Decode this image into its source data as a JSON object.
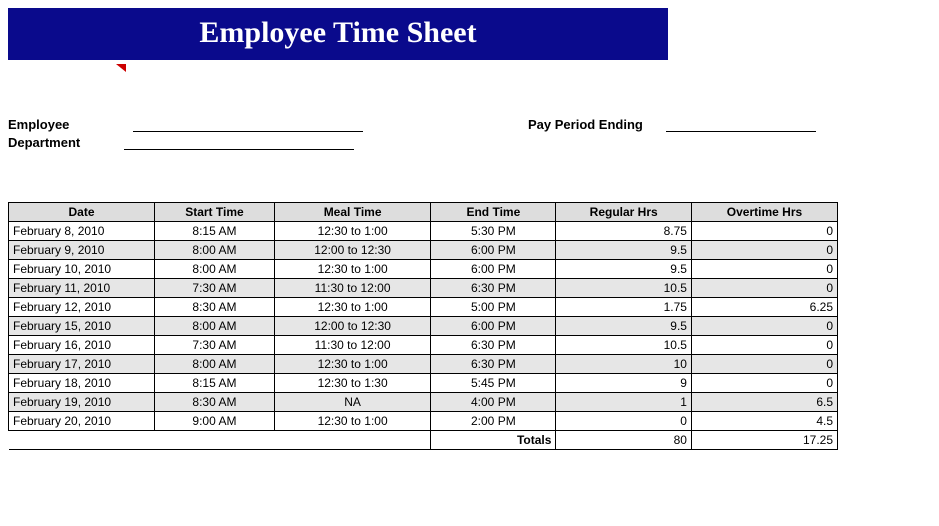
{
  "title": "Employee Time Sheet",
  "labels": {
    "employee": "Employee",
    "department": "Department",
    "pay_period_ending": "Pay Period Ending"
  },
  "columns": {
    "date": "Date",
    "start": "Start Time",
    "meal": "Meal Time",
    "end": "End Time",
    "regular": "Regular Hrs",
    "overtime": "Overtime Hrs"
  },
  "rows": [
    {
      "date": "February 8, 2010",
      "start": "8:15 AM",
      "meal": "12:30 to 1:00",
      "end": "5:30 PM",
      "regular": "8.75",
      "overtime": "0"
    },
    {
      "date": "February 9, 2010",
      "start": "8:00 AM",
      "meal": "12:00 to 12:30",
      "end": "6:00 PM",
      "regular": "9.5",
      "overtime": "0"
    },
    {
      "date": "February 10, 2010",
      "start": "8:00 AM",
      "meal": "12:30 to 1:00",
      "end": "6:00 PM",
      "regular": "9.5",
      "overtime": "0"
    },
    {
      "date": "February 11, 2010",
      "start": "7:30 AM",
      "meal": "11:30 to 12:00",
      "end": "6:30 PM",
      "regular": "10.5",
      "overtime": "0"
    },
    {
      "date": "February 12, 2010",
      "start": "8:30 AM",
      "meal": "12:30 to 1:00",
      "end": "5:00 PM",
      "regular": "1.75",
      "overtime": "6.25"
    },
    {
      "date": "February 15, 2010",
      "start": "8:00 AM",
      "meal": "12:00 to 12:30",
      "end": "6:00 PM",
      "regular": "9.5",
      "overtime": "0"
    },
    {
      "date": "February 16, 2010",
      "start": "7:30 AM",
      "meal": "11:30 to 12:00",
      "end": "6:30 PM",
      "regular": "10.5",
      "overtime": "0"
    },
    {
      "date": "February 17, 2010",
      "start": "8:00 AM",
      "meal": "12:30 to 1:00",
      "end": "6:30 PM",
      "regular": "10",
      "overtime": "0"
    },
    {
      "date": "February 18, 2010",
      "start": "8:15 AM",
      "meal": "12:30 to 1:30",
      "end": "5:45 PM",
      "regular": "9",
      "overtime": "0"
    },
    {
      "date": "February 19, 2010",
      "start": "8:30 AM",
      "meal": "NA",
      "end": "4:00 PM",
      "regular": "1",
      "overtime": "6.5"
    },
    {
      "date": "February 20, 2010",
      "start": "9:00 AM",
      "meal": "12:30 to 1:00",
      "end": "2:00 PM",
      "regular": "0",
      "overtime": "4.5"
    }
  ],
  "totals": {
    "label": "Totals",
    "regular": "80",
    "overtime": "17.25"
  },
  "chart_data": {
    "type": "table",
    "title": "Employee Time Sheet",
    "columns": [
      "Date",
      "Start Time",
      "Meal Time",
      "End Time",
      "Regular Hrs",
      "Overtime Hrs"
    ],
    "rows": [
      [
        "February 8, 2010",
        "8:15 AM",
        "12:30 to 1:00",
        "5:30 PM",
        8.75,
        0
      ],
      [
        "February 9, 2010",
        "8:00 AM",
        "12:00 to 12:30",
        "6:00 PM",
        9.5,
        0
      ],
      [
        "February 10, 2010",
        "8:00 AM",
        "12:30 to 1:00",
        "6:00 PM",
        9.5,
        0
      ],
      [
        "February 11, 2010",
        "7:30 AM",
        "11:30 to 12:00",
        "6:30 PM",
        10.5,
        0
      ],
      [
        "February 12, 2010",
        "8:30 AM",
        "12:30 to 1:00",
        "5:00 PM",
        1.75,
        6.25
      ],
      [
        "February 15, 2010",
        "8:00 AM",
        "12:00 to 12:30",
        "6:00 PM",
        9.5,
        0
      ],
      [
        "February 16, 2010",
        "7:30 AM",
        "11:30 to 12:00",
        "6:30 PM",
        10.5,
        0
      ],
      [
        "February 17, 2010",
        "8:00 AM",
        "12:30 to 1:00",
        "6:30 PM",
        10,
        0
      ],
      [
        "February 18, 2010",
        "8:15 AM",
        "12:30 to 1:30",
        "5:45 PM",
        9,
        0
      ],
      [
        "February 19, 2010",
        "8:30 AM",
        "NA",
        "4:00 PM",
        1,
        6.5
      ],
      [
        "February 20, 2010",
        "9:00 AM",
        "12:30 to 1:00",
        "2:00 PM",
        0,
        4.5
      ]
    ],
    "totals": {
      "Regular Hrs": 80,
      "Overtime Hrs": 17.25
    }
  }
}
